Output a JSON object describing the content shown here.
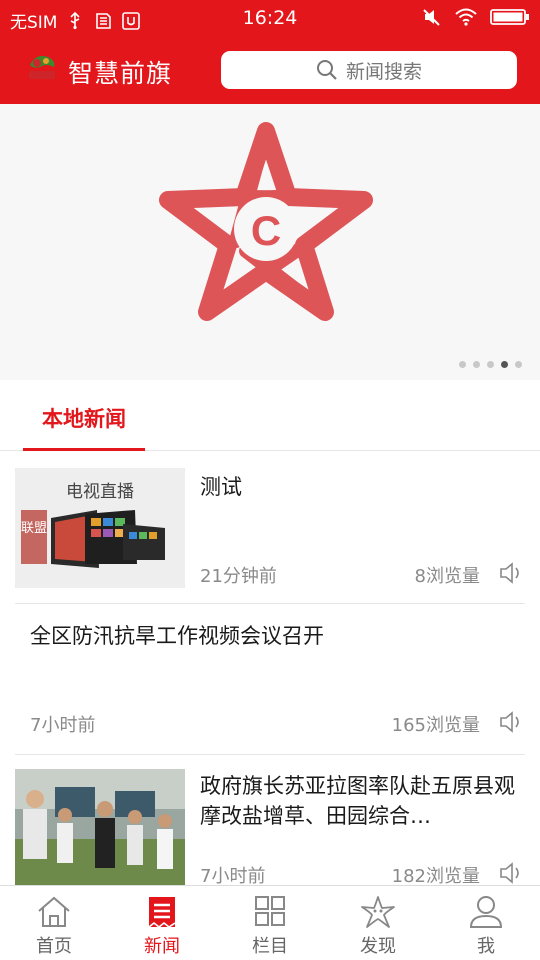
{
  "status_bar": {
    "carrier": "无SIM",
    "time": "16:24",
    "icons": [
      "usb-icon",
      "sd-icon",
      "debug-icon",
      "mute-icon",
      "wifi-icon",
      "battery-icon"
    ]
  },
  "header": {
    "app_title": "智慧前旗",
    "search_placeholder": "新闻搜索",
    "logo_text": "联盟"
  },
  "banner": {
    "star_letter": "C",
    "slide_count": 5,
    "active_slide": 4
  },
  "tabs": [
    {
      "label": "本地新闻",
      "active": true
    }
  ],
  "news": [
    {
      "title": "测试",
      "time": "21分钟前",
      "views": "8浏览量",
      "thumb_caption": "电视直播",
      "thumb_stamp": "联盟"
    },
    {
      "title": "全区防汛抗旱工作视频会议召开",
      "time": "7小时前",
      "views": "165浏览量"
    },
    {
      "title": "政府旗长苏亚拉图率队赴五原县观摩改盐增草、田园综合…",
      "time": "7小时前",
      "views": "182浏览量"
    }
  ],
  "bottom_nav": [
    {
      "label": "首页",
      "icon": "home-icon",
      "active": false
    },
    {
      "label": "新闻",
      "icon": "news-icon",
      "active": true
    },
    {
      "label": "栏目",
      "icon": "grid-icon",
      "active": false
    },
    {
      "label": "发现",
      "icon": "starfish-icon",
      "active": false
    },
    {
      "label": "我",
      "icon": "person-icon",
      "active": false
    }
  ],
  "colors": {
    "brand_red": "#e2161b",
    "star_red": "#de5558",
    "text_dark": "#1a1a1a",
    "text_gray": "#8a8a8a"
  }
}
